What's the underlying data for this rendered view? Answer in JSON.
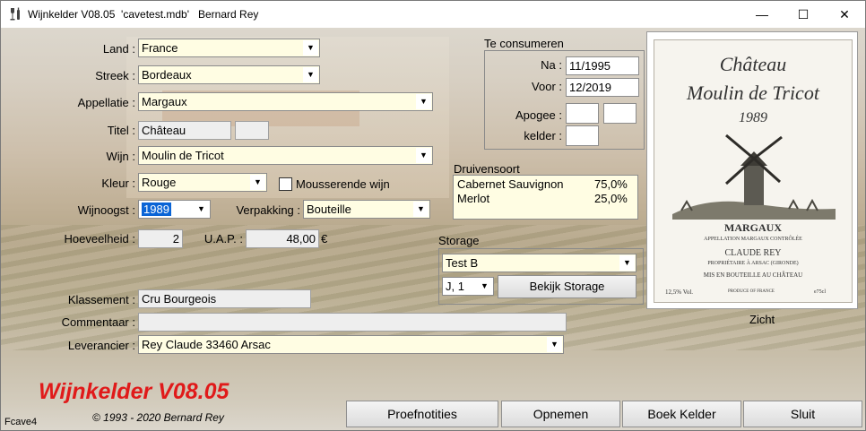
{
  "window": {
    "title": "Wijnkelder V08.05  'cavetest.mdb'   Bernard Rey",
    "controls": {
      "minimize": "—",
      "maximize": "☐",
      "close": "✕"
    }
  },
  "form": {
    "land": {
      "label": "Land :",
      "value": "France"
    },
    "streek": {
      "label": "Streek :",
      "value": "Bordeaux"
    },
    "appellatie": {
      "label": "Appellatie :",
      "value": "Margaux"
    },
    "titel": {
      "label": "Titel :",
      "value": "Château",
      "value2": ""
    },
    "wijn": {
      "label": "Wijn :",
      "value": "Moulin de Tricot"
    },
    "kleur": {
      "label": "Kleur :",
      "value": "Rouge"
    },
    "mousserende": {
      "label": "Mousserende wijn",
      "checked": false
    },
    "wijnoogst": {
      "label": "Wijnoogst :",
      "value": "1989"
    },
    "verpakking": {
      "label": "Verpakking :",
      "value": "Bouteille"
    },
    "hoeveelheid": {
      "label": "Hoeveelheid :",
      "value": "2"
    },
    "uap": {
      "label": "U.A.P. :",
      "value": "48,00",
      "currency": "€"
    },
    "klassement": {
      "label": "Klassement :",
      "value": "Cru Bourgeois"
    },
    "commentaar": {
      "label": "Commentaar :",
      "value": ""
    },
    "leverancier": {
      "label": "Leverancier :",
      "value": "Rey Claude 33460 Arsac"
    }
  },
  "consumeren": {
    "title": "Te consumeren",
    "na": {
      "label": "Na :",
      "value": "11/1995"
    },
    "voor": {
      "label": "Voor :",
      "value": "12/2019"
    },
    "apogee": {
      "label": "Apogee :",
      "value1": "",
      "value2": ""
    },
    "kelder": {
      "label": "kelder :",
      "value": ""
    }
  },
  "druivensoort": {
    "title": "Druivensoort",
    "items": [
      {
        "name": "Cabernet Sauvignon",
        "pct": "75,0%"
      },
      {
        "name": "Merlot",
        "pct": "25,0%"
      }
    ]
  },
  "storage": {
    "title": "Storage",
    "location": "Test B",
    "slot": "J, 1",
    "button": "Bekijk Storage"
  },
  "wine_label": {
    "line1": "Château",
    "line2": "Moulin de Tricot",
    "year": "1989",
    "appellation": "MARGAUX",
    "sub": "APPELLATION MARGAUX CONTRÔLÉE",
    "producer": "CLAUDE REY",
    "owner": "PROPRIÉTAIRE À ARSAC (GIRONDE)",
    "bottled": "MIS EN BOUTEILLE AU CHÂTEAU",
    "vol": "12,5% Vol.",
    "origin": "PRODUCE OF FRANCE",
    "size": "e75cl",
    "caption": "Zicht"
  },
  "footer": {
    "brand": "Wijnkelder V08.05",
    "copyright": "© 1993 - 2020 Bernard Rey",
    "form_id": "Fcave4",
    "buttons": [
      "Proefnotities",
      "Opnemen",
      "Boek Kelder",
      "Sluit"
    ]
  },
  "colors": {
    "field": "#fffde3",
    "brand": "#e01a1a",
    "selection": "#0a64d6"
  }
}
